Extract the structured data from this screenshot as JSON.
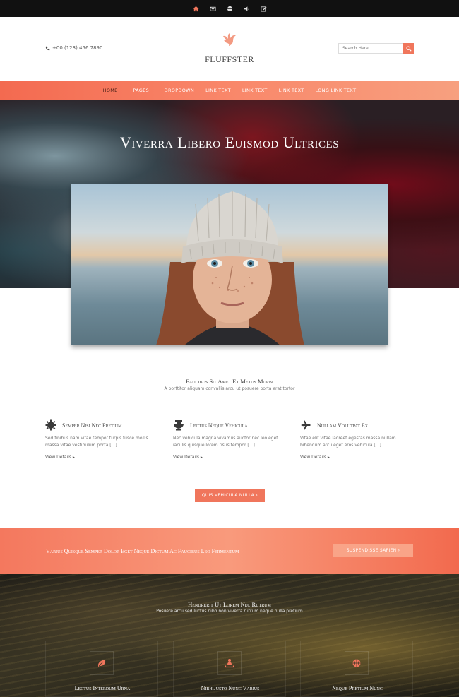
{
  "topbar": {
    "icons": [
      "home-icon",
      "mail-icon",
      "globe-icon",
      "volume-icon",
      "edit-icon"
    ]
  },
  "header": {
    "phone": "+00 (123) 456 7890",
    "brand": "FLUFFSTER",
    "search_placeholder": "Search Here..."
  },
  "nav": {
    "items": [
      "HOME",
      "+PAGES",
      "+DROPDOWN",
      "LINK TEXT",
      "LINK TEXT",
      "LINK TEXT",
      "LONG LINK TEXT"
    ]
  },
  "hero": {
    "title": "Viverra Libero Euismod Ultrices"
  },
  "intro": {
    "title": "Faucibus Sit Amet Et Metus Morbi",
    "subtitle": "A porttitor aliquam convallis arcu ut posuere porta erat tortor"
  },
  "features": [
    {
      "icon": "gear-icon",
      "title": "Semper Nisi Nec Pretium",
      "text": "Sed finibus nam vitae tempor turpis fusce mollis massa vitae vestibulum porta [...]",
      "link": "View Details"
    },
    {
      "icon": "mortar-icon",
      "title": "Lectus Neque Vehicula",
      "text": "Nec vehicula magna vivamus auctor nec leo eget iaculis quisque lorem risus tempor [...]",
      "link": "View Details"
    },
    {
      "icon": "airplane-icon",
      "title": "Nullam Volutpat Ex",
      "text": "Vitae elit vitae laoreet egestas massa nullam bibendum arcu eget eros vehicula [...]",
      "link": "View Details"
    }
  ],
  "intro_button": "QUIS VEHICULA NULLA",
  "cta": {
    "text": "Varius Quisque Semper Dolor Eget Neque Dictum Ac Faucibus Leo Fermentum",
    "button": "SUSPENDISSE SAPIEN"
  },
  "dark_section": {
    "title": "Hendrerit Ut Lorem Nec Rutrum",
    "subtitle": "Posuere arcu sed luctus nibh non viverra rutrum neque nulla pretium",
    "cards": [
      {
        "icon": "leaf-icon",
        "title": "Lectus Interdum Urna"
      },
      {
        "icon": "person-upload-icon",
        "title": "Nibh Justo Nunc Varius"
      },
      {
        "icon": "basketball-icon",
        "title": "Neque Pretium Nunc"
      }
    ]
  },
  "colors": {
    "accent": "#f0765c",
    "nav_start": "#f36a50",
    "nav_end": "#f7a07f",
    "topbar": "#111111"
  }
}
